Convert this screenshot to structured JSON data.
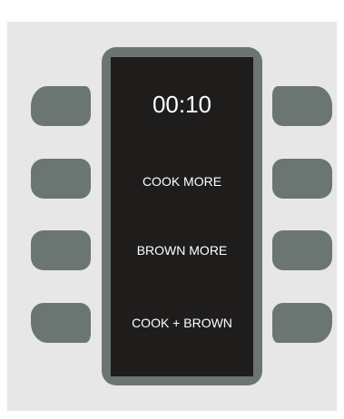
{
  "display": {
    "timer": "00:10",
    "options": [
      "COOK MORE",
      "BROWN MORE",
      "COOK + BROWN"
    ]
  },
  "colors": {
    "panel": "#e7e7e7",
    "bezel": "#6b7572",
    "screen": "#1f1c1c",
    "text": "#ffffff",
    "button": "#6b7572"
  }
}
